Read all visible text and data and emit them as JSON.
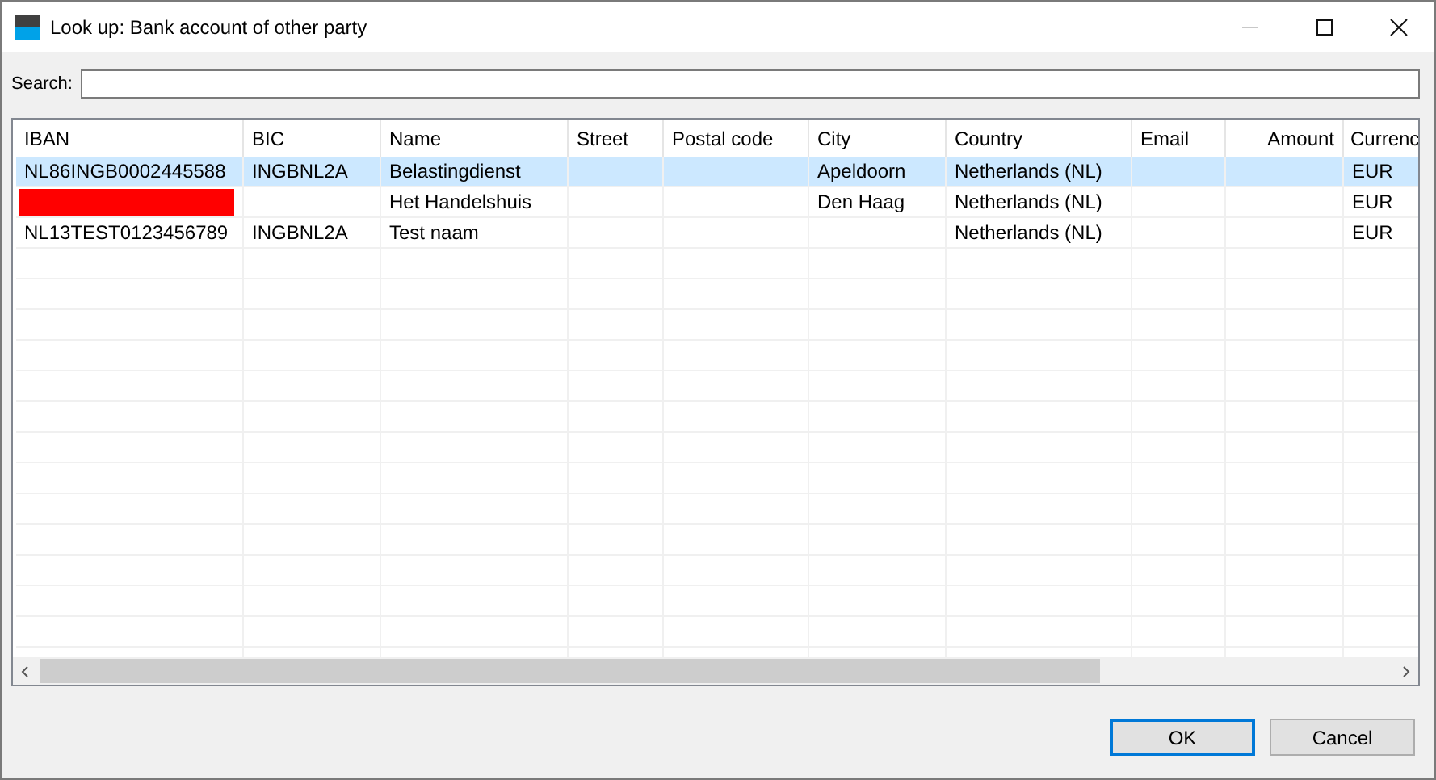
{
  "window": {
    "title": "Look up: Bank account of other party"
  },
  "search": {
    "label": "Search:"
  },
  "table": {
    "columns": [
      "IBAN",
      "BIC",
      "Name",
      "Street",
      "Postal code",
      "City",
      "Country",
      "Email",
      "Amount",
      "Currenc"
    ],
    "rows": [
      {
        "selected": true,
        "cells": [
          "NL86INGB0002445588",
          "INGBNL2A",
          "Belastingdienst",
          "",
          "",
          "Apeldoorn",
          "Netherlands (NL)",
          "",
          "",
          "EUR"
        ]
      },
      {
        "selected": false,
        "cells": [
          {
            "kind": "redacted"
          },
          "",
          "Het Handelshuis",
          "",
          "",
          "Den Haag",
          "Netherlands (NL)",
          "",
          "",
          "EUR"
        ]
      },
      {
        "selected": false,
        "cells": [
          "NL13TEST0123456789",
          "INGBNL2A",
          "Test naam",
          "",
          "",
          "",
          "Netherlands (NL)",
          "",
          "",
          "EUR"
        ]
      }
    ]
  },
  "buttons": [
    {
      "label": "OK",
      "default": true
    },
    {
      "label": "Cancel",
      "default": false
    }
  ]
}
